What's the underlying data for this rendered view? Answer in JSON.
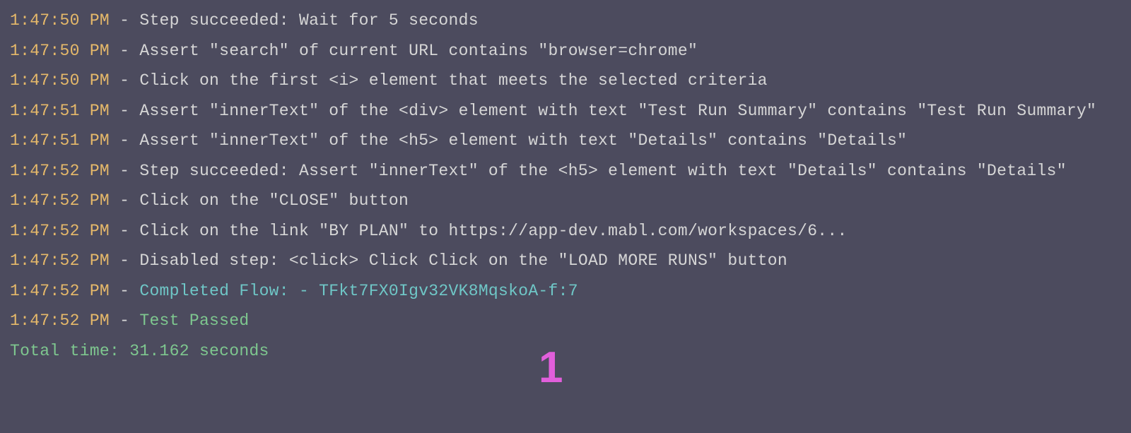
{
  "log_entries": [
    {
      "timestamp": "1:47:50 PM",
      "sep": " - ",
      "message": "Step succeeded: Wait for 5 seconds",
      "type": "msg"
    },
    {
      "timestamp": "1:47:50 PM",
      "sep": " - ",
      "message": "Assert \"search\" of current URL contains \"browser=chrome\"",
      "type": "msg"
    },
    {
      "timestamp": "1:47:50 PM",
      "sep": " - ",
      "message": "Click on the first <i> element that meets the selected criteria",
      "type": "msg"
    },
    {
      "timestamp": "1:47:51 PM",
      "sep": " - ",
      "message": "Assert \"innerText\" of the <div> element with text \"Test Run Summary\" contains \"Test Run Summary\"",
      "type": "msg"
    },
    {
      "timestamp": "1:47:51 PM",
      "sep": " - ",
      "message": "Assert \"innerText\" of the <h5> element with text \"Details\" contains \"Details\"",
      "type": "msg"
    },
    {
      "timestamp": "1:47:52 PM",
      "sep": " - ",
      "message": "Step succeeded: Assert \"innerText\" of the <h5> element with text \"Details\" contains \"Details\"",
      "type": "msg"
    },
    {
      "timestamp": "1:47:52 PM",
      "sep": " - ",
      "message": "Click on the \"CLOSE\" button",
      "type": "msg"
    },
    {
      "timestamp": "1:47:52 PM",
      "sep": " - ",
      "message": "Click on the link \"BY PLAN\" to https://app-dev.mabl.com/workspaces/6...",
      "type": "msg"
    },
    {
      "timestamp": "1:47:52 PM",
      "sep": " - ",
      "message": "Disabled step: <click> Click Click on the \"LOAD MORE RUNS\" button",
      "type": "msg"
    },
    {
      "timestamp": "1:47:52 PM",
      "sep": " - ",
      "message": "Completed Flow: - TFkt7FX0Igv32VK8MqskoA-f:7",
      "type": "flow"
    },
    {
      "timestamp": "1:47:52 PM",
      "sep": " - ",
      "message": "Test Passed",
      "type": "passed"
    }
  ],
  "footer": "Total time: 31.162 seconds",
  "annotation": "1"
}
